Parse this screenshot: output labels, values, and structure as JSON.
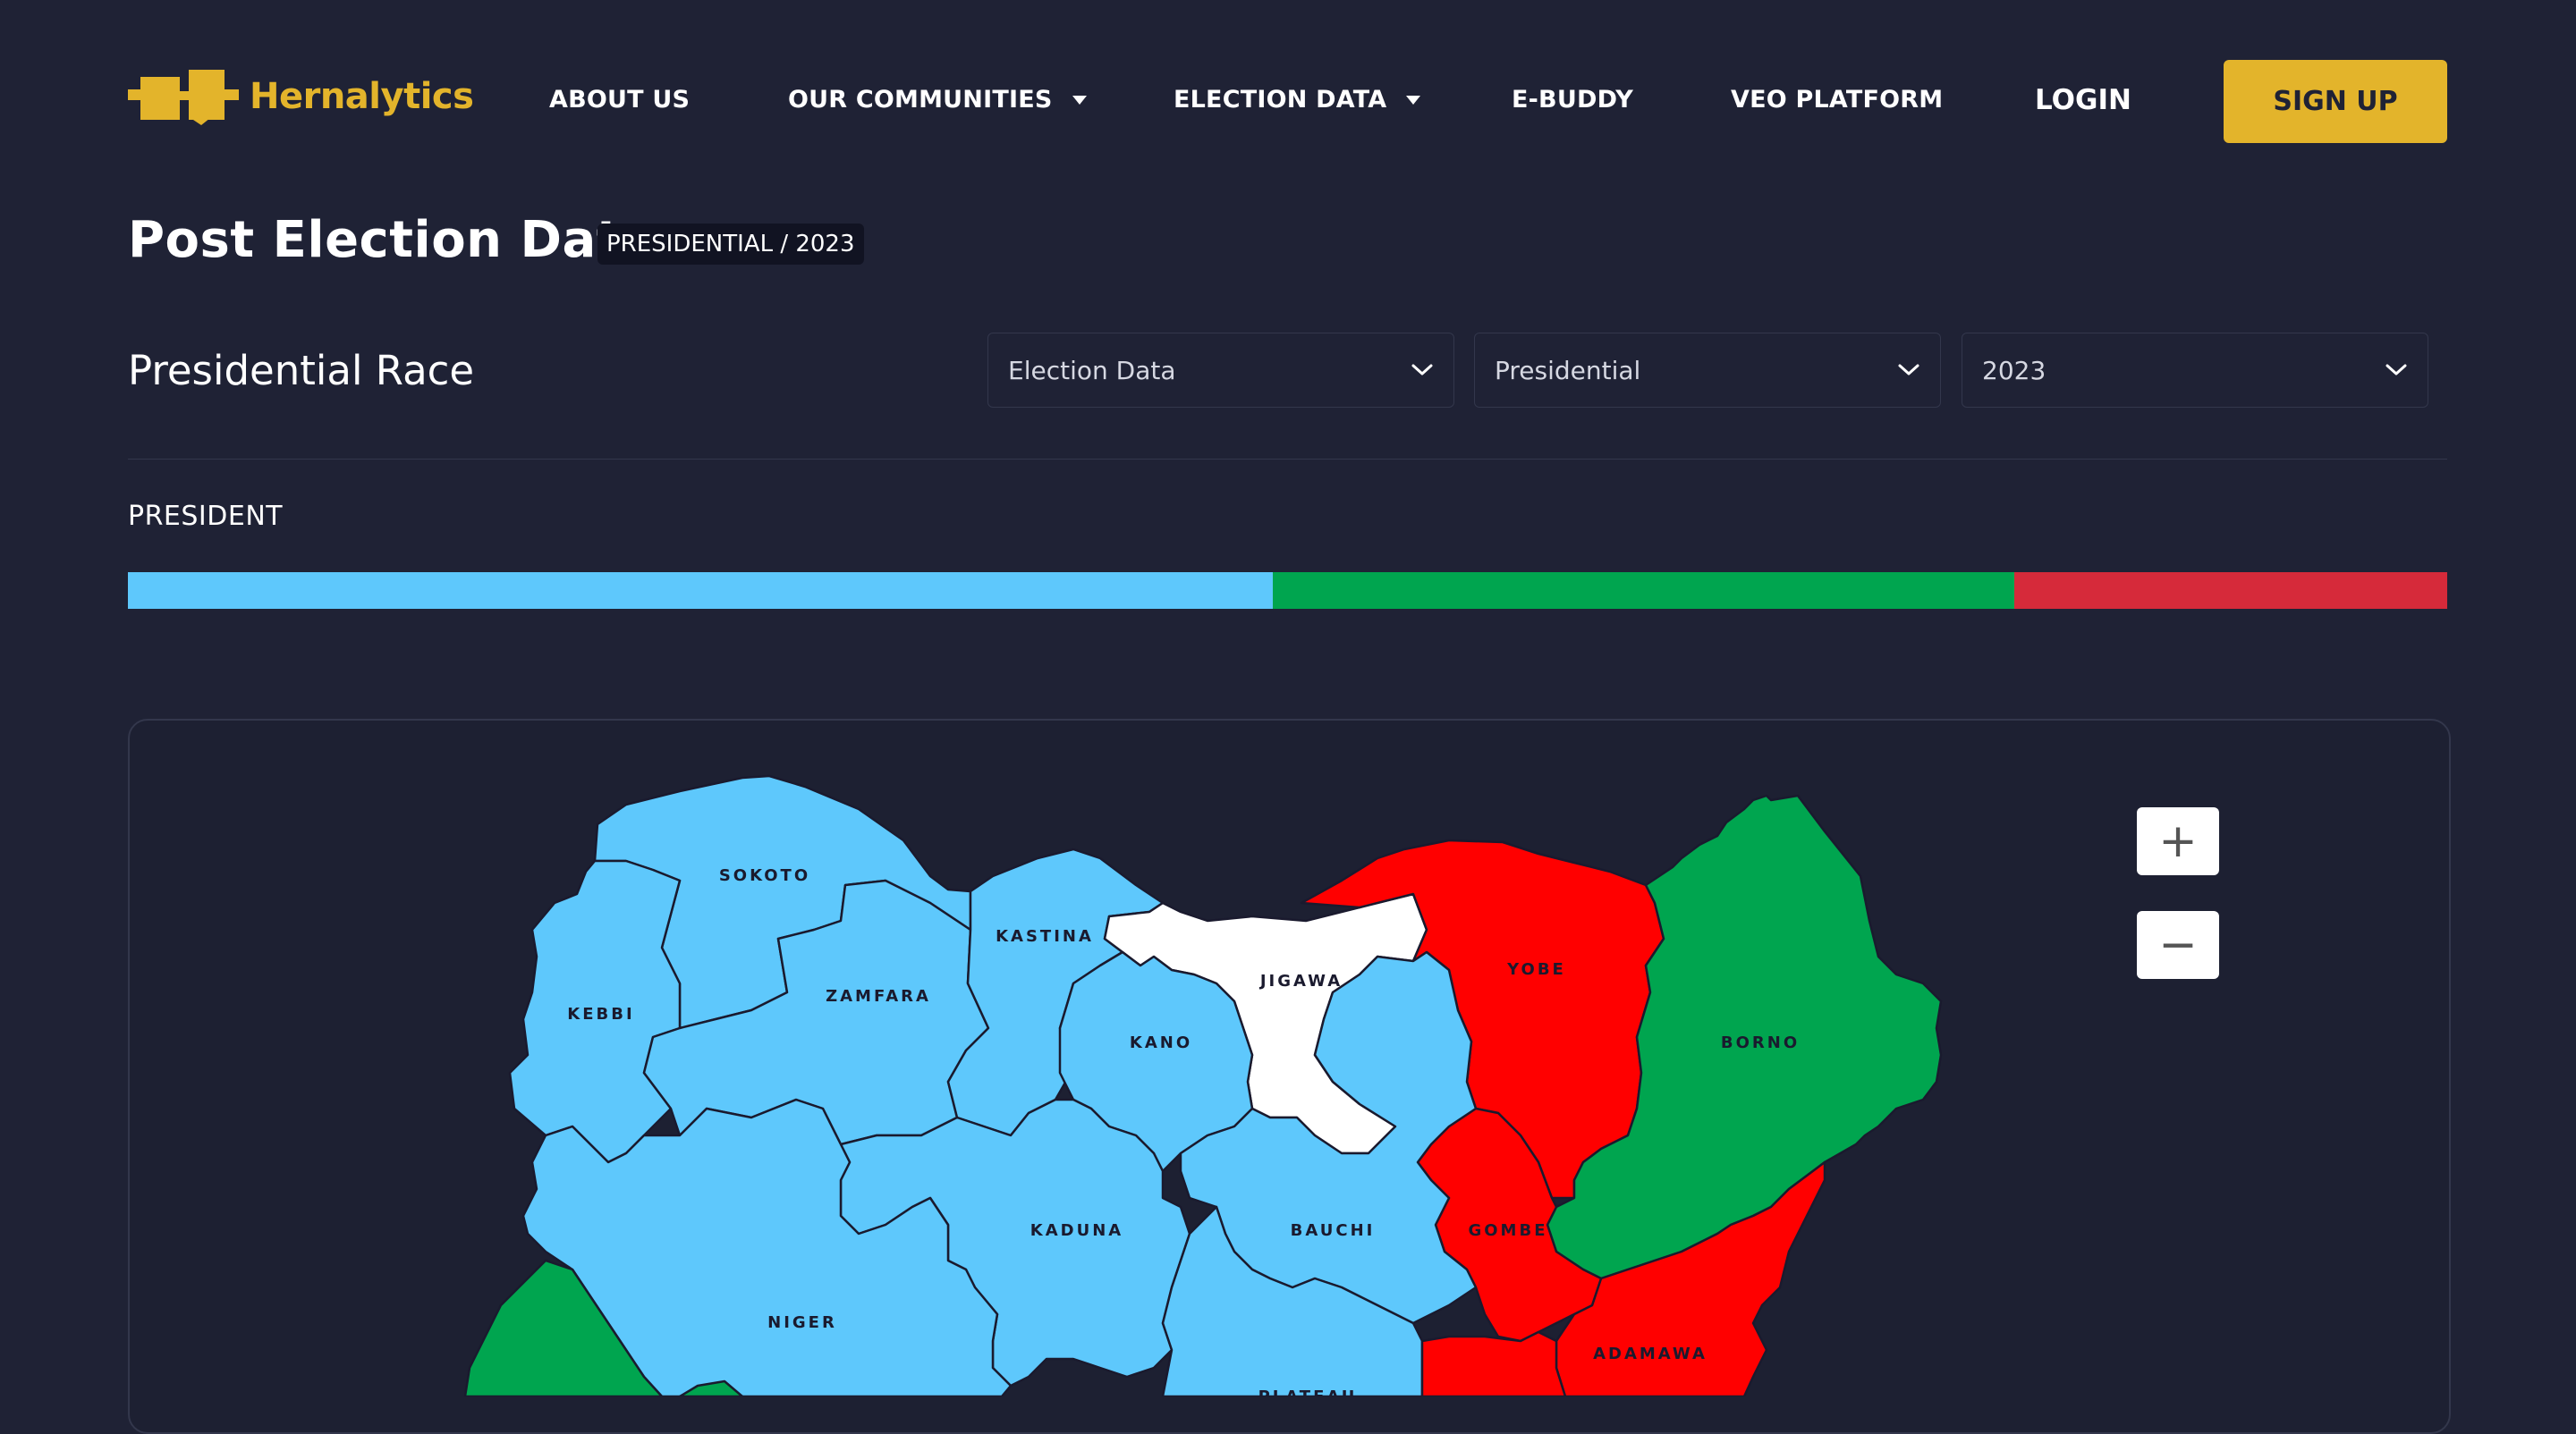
{
  "brand": {
    "name": "Hernalytics",
    "color": "#e3b42b"
  },
  "nav": {
    "about": "ABOUT US",
    "communities": "OUR COMMUNITIES",
    "election_data": "ELECTION DATA",
    "ebuddy": "E-BUDDY",
    "veo": "VEO PLATFORM",
    "login": "LOGIN",
    "signup": "SIGN UP"
  },
  "page": {
    "title": "Post Election Data",
    "breadcrumb": "PRESIDENTIAL / 2023",
    "race_title": "Presidential Race",
    "section_label": "PRESIDENT"
  },
  "filters": {
    "category": "Election Data",
    "type": "Presidential",
    "year": "2023"
  },
  "vote_bar": [
    {
      "color": "#5ec8fc",
      "share": 0.4935
    },
    {
      "color": "#00a54f",
      "share": 0.3198
    },
    {
      "color": "#d62a3a",
      "share": 0.1867
    }
  ],
  "map": {
    "colors": {
      "light_blue": "#5ec8fc",
      "green": "#00a54f",
      "red": "#ff0000",
      "white": "#ffffff"
    },
    "states": [
      {
        "name": "SOKOTO",
        "color": "#5ec8fc"
      },
      {
        "name": "KASTINA",
        "color": "#5ec8fc"
      },
      {
        "name": "ZAMFARA",
        "color": "#5ec8fc"
      },
      {
        "name": "KEBBI",
        "color": "#5ec8fc"
      },
      {
        "name": "JIGAWA",
        "color": "#ffffff"
      },
      {
        "name": "KANO",
        "color": "#5ec8fc"
      },
      {
        "name": "YOBE",
        "color": "#ff0000"
      },
      {
        "name": "BORNO",
        "color": "#00a54f"
      },
      {
        "name": "KADUNA",
        "color": "#5ec8fc"
      },
      {
        "name": "BAUCHI",
        "color": "#5ec8fc"
      },
      {
        "name": "GOMBE",
        "color": "#ff0000"
      },
      {
        "name": "NIGER",
        "color": "#5ec8fc"
      },
      {
        "name": "ADAMAWA",
        "color": "#ff0000"
      },
      {
        "name": "PLATEAU",
        "color": "#5ec8fc"
      }
    ],
    "zoom_in": "+",
    "zoom_out": "−"
  }
}
